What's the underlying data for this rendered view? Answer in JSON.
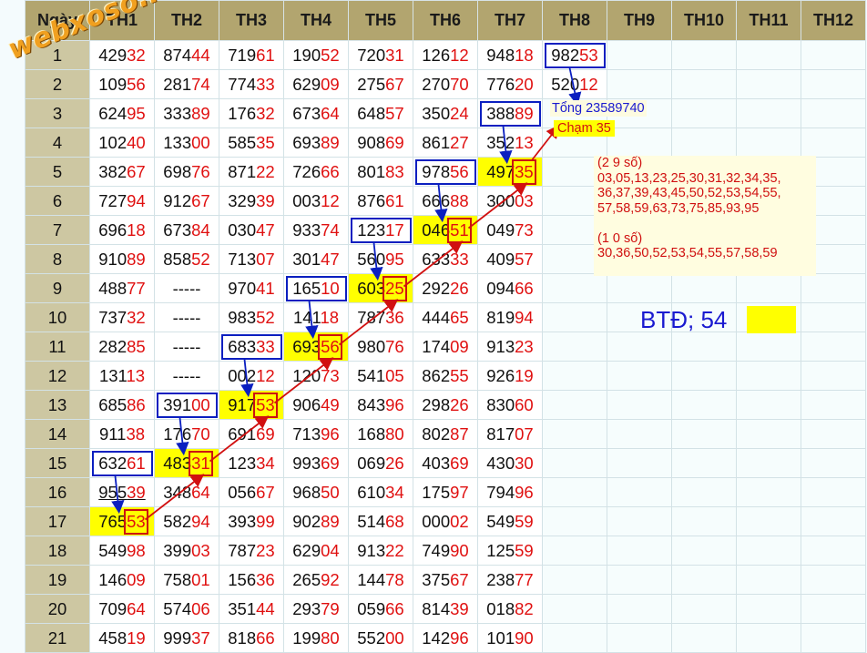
{
  "watermark": "webxoso.net",
  "headers": [
    "Ngày",
    "TH1",
    "TH2",
    "TH3",
    "TH4",
    "TH5",
    "TH6",
    "TH7",
    "TH8",
    "TH9",
    "TH10",
    "TH11",
    "TH12"
  ],
  "rows": [
    {
      "day": "1",
      "v": [
        "42932",
        "87444",
        "71961",
        "19052",
        "72031",
        "12612",
        "94818",
        "98253"
      ]
    },
    {
      "day": "2",
      "v": [
        "10956",
        "28174",
        "77433",
        "62909",
        "27567",
        "27070",
        "77620",
        "52012"
      ]
    },
    {
      "day": "3",
      "v": [
        "62495",
        "33389",
        "17632",
        "67364",
        "64857",
        "35024",
        "38889"
      ]
    },
    {
      "day": "4",
      "v": [
        "10240",
        "13300",
        "58535",
        "69389",
        "90869",
        "86127",
        "35213"
      ]
    },
    {
      "day": "5",
      "v": [
        "38267",
        "69876",
        "87122",
        "72666",
        "80183",
        "97856",
        "49735"
      ]
    },
    {
      "day": "6",
      "v": [
        "72794",
        "91267",
        "32939",
        "00312",
        "87661",
        "66688",
        "30003"
      ]
    },
    {
      "day": "7",
      "v": [
        "69618",
        "67384",
        "03047",
        "93374",
        "12317",
        "04651",
        "04973"
      ]
    },
    {
      "day": "8",
      "v": [
        "91089",
        "85852",
        "71307",
        "30147",
        "56095",
        "63333",
        "40957"
      ]
    },
    {
      "day": "9",
      "v": [
        "48877",
        "-----",
        "97041",
        "16510",
        "60325",
        "29226",
        "09466"
      ]
    },
    {
      "day": "10",
      "v": [
        "73732",
        "-----",
        "98352",
        "14118",
        "78736",
        "44465",
        "81994"
      ]
    },
    {
      "day": "11",
      "v": [
        "28285",
        "-----",
        "68333",
        "69356",
        "98076",
        "17409",
        "91323"
      ]
    },
    {
      "day": "12",
      "v": [
        "13113",
        "-----",
        "00212",
        "12073",
        "54105",
        "86255",
        "92619"
      ]
    },
    {
      "day": "13",
      "v": [
        "68586",
        "39100",
        "91753",
        "90649",
        "84396",
        "29826",
        "83060"
      ]
    },
    {
      "day": "14",
      "v": [
        "91138",
        "17670",
        "69169",
        "71396",
        "16880",
        "80287",
        "81707"
      ]
    },
    {
      "day": "15",
      "v": [
        "63261",
        "48331",
        "12334",
        "99369",
        "06926",
        "40369",
        "43030"
      ]
    },
    {
      "day": "16",
      "v": [
        "95539",
        "34864",
        "05667",
        "96850",
        "61034",
        "17597",
        "79496"
      ]
    },
    {
      "day": "17",
      "v": [
        "76553",
        "58294",
        "39399",
        "90289",
        "51468",
        "00002",
        "54959"
      ]
    },
    {
      "day": "18",
      "v": [
        "54998",
        "39903",
        "78723",
        "62904",
        "91322",
        "74990",
        "12559"
      ]
    },
    {
      "day": "19",
      "v": [
        "14609",
        "75801",
        "15636",
        "26592",
        "14478",
        "37567",
        "23877"
      ]
    },
    {
      "day": "20",
      "v": [
        "70964",
        "57406",
        "35144",
        "29379",
        "05966",
        "81439",
        "01882"
      ]
    },
    {
      "day": "21",
      "v": [
        "45819",
        "99937",
        "81866",
        "19980",
        "55200",
        "14296",
        "10190"
      ]
    }
  ],
  "highlighted_cells": [
    [
      4,
      6
    ],
    [
      6,
      5
    ],
    [
      8,
      4
    ],
    [
      10,
      3
    ],
    [
      12,
      2
    ],
    [
      14,
      1
    ],
    [
      16,
      0
    ]
  ],
  "blue_boxed_cells": [
    [
      0,
      7
    ],
    [
      2,
      6
    ],
    [
      4,
      5
    ],
    [
      6,
      4
    ],
    [
      8,
      3
    ],
    [
      10,
      2
    ],
    [
      12,
      1
    ],
    [
      14,
      0
    ]
  ],
  "red_boxed_tail_cells": [
    [
      4,
      6
    ],
    [
      6,
      5
    ],
    [
      8,
      4
    ],
    [
      10,
      3
    ],
    [
      12,
      2
    ],
    [
      14,
      1
    ],
    [
      16,
      0
    ]
  ],
  "underlined_cells": [
    [
      15,
      0
    ]
  ],
  "notes": {
    "total": "Tổng 23589740",
    "touch": "Chạm 35",
    "info_lines": [
      "(2 9 số)",
      "03,05,13,23,25,30,31,32,34,35,",
      "36,37,39,43,45,50,52,53,54,55,",
      "57,58,59,63,73,75,85,93,95",
      "",
      "(1 0 số)",
      "30,36,50,52,53,54,55,57,58,59"
    ],
    "btd": "BTĐ; 54"
  },
  "colors": {
    "header_bg": "#b2a56f",
    "day_bg": "#cdc7a2",
    "digit_red": "#e01010",
    "highlight": "#ffff00",
    "blue_box": "#0b1fc0",
    "red_box": "#d11010",
    "btd_text": "#1a1ad0"
  }
}
